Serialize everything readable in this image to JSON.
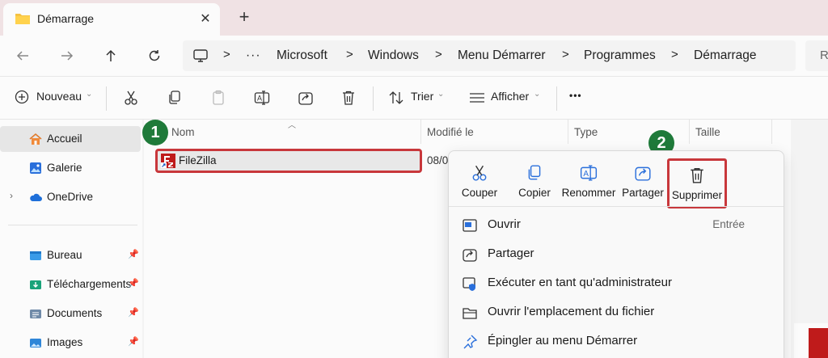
{
  "tab": {
    "title": "Démarrage",
    "close_glyph": "✕",
    "new_glyph": "+"
  },
  "address": {
    "overflow_glyph": "···",
    "crumbs": [
      "Microsoft",
      "Windows",
      "Menu Démarrer",
      "Programmes",
      "Démarrage"
    ],
    "separator": ">",
    "search_partial": "Re"
  },
  "commands": {
    "new_label": "Nouveau",
    "sort_label": "Trier",
    "view_label": "Afficher",
    "more_glyph": "•••"
  },
  "sidebar": {
    "items": [
      {
        "label": "Accueil",
        "icon": "home-icon"
      },
      {
        "label": "Galerie",
        "icon": "gallery-icon"
      },
      {
        "label": "OneDrive",
        "icon": "cloud-icon"
      },
      {
        "label": "Bureau",
        "icon": "desktop-folder-icon"
      },
      {
        "label": "Téléchargements",
        "icon": "downloads-folder-icon"
      },
      {
        "label": "Documents",
        "icon": "documents-folder-icon"
      },
      {
        "label": "Images",
        "icon": "images-folder-icon"
      }
    ]
  },
  "columns": {
    "name": "Nom",
    "modified": "Modifié le",
    "type": "Type",
    "size": "Taille"
  },
  "file": {
    "name": "FileZilla",
    "modified_partial": "08/0"
  },
  "steps": {
    "one": "1",
    "two": "2"
  },
  "context_menu": {
    "quick_actions": [
      "Couper",
      "Copier",
      "Renommer",
      "Partager",
      "Supprimer"
    ],
    "items": [
      {
        "label": "Ouvrir",
        "shortcut": "Entrée",
        "icon": "open-icon"
      },
      {
        "label": "Partager",
        "shortcut": "",
        "icon": "share-icon"
      },
      {
        "label": "Exécuter en tant qu'administrateur",
        "shortcut": "",
        "icon": "admin-shield-icon"
      },
      {
        "label": "Ouvrir l'emplacement du fichier",
        "shortcut": "",
        "icon": "folder-open-icon"
      },
      {
        "label": "Épingler au menu Démarrer",
        "shortcut": "",
        "icon": "pin-icon"
      }
    ]
  },
  "colors": {
    "highlight_border": "#c8373b",
    "step_badge": "#1f7a3a",
    "accent_blue": "#2a6fdb",
    "filezilla_red": "#bf1b1b"
  }
}
